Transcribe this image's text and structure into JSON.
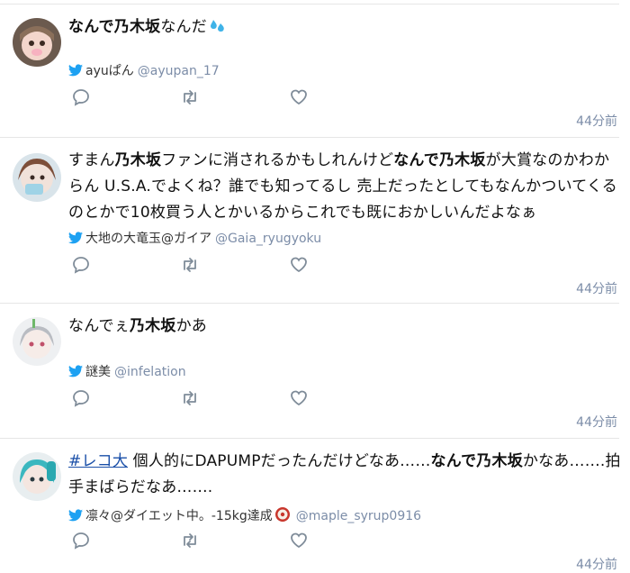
{
  "tweets": [
    {
      "segments": [
        {
          "text": "なんで乃木坂",
          "bold": true
        },
        {
          "text": "なんだ",
          "bold": false
        }
      ],
      "emoji": "sweat-drops-icon",
      "author_name": "ayuぱん",
      "handle": "@ayupan_17",
      "time": "44分前"
    },
    {
      "segments": [
        {
          "text": "すまん",
          "bold": false
        },
        {
          "text": "乃木坂",
          "bold": true
        },
        {
          "text": "ファンに消されるかもしれんけど",
          "bold": false
        },
        {
          "text": "なんで乃木坂",
          "bold": true
        },
        {
          "text": "が大賞なのかわからん U.S.A.でよくね？誰でも知ってるし 売上だったとしてもなんかついてくるのとかで10枚買う人とかいるからこれでも既におかしいんだよなぁ",
          "bold": false
        }
      ],
      "author_name": "大地の大竜玉@ガイア",
      "handle": "@Gaia_ryugyoku",
      "time": "44分前"
    },
    {
      "segments": [
        {
          "text": "なんでぇ",
          "bold": false
        },
        {
          "text": "乃木坂",
          "bold": true
        },
        {
          "text": "かあ",
          "bold": false
        }
      ],
      "author_name": "謎美",
      "handle": "@infelation",
      "time": "44分前"
    },
    {
      "hashtag": "#レコ大",
      "segments": [
        {
          "text": " 個人的にDAPUMPだったんだけどなあ……",
          "bold": false
        },
        {
          "text": "なんで乃木坂",
          "bold": true
        },
        {
          "text": "かなあ…….拍手まばらだなあ…….",
          "bold": false
        }
      ],
      "author_name": "凛々@ダイエット中。-15kg達成",
      "author_emoji": "rice-ball-icon",
      "handle": "@maple_syrup0916",
      "time": "44分前"
    }
  ],
  "colors": {
    "twitter_blue": "#1da1f2",
    "handle": "#7c8da8",
    "icon_gray": "#7f8c99",
    "hashtag": "#1a4fa8"
  }
}
